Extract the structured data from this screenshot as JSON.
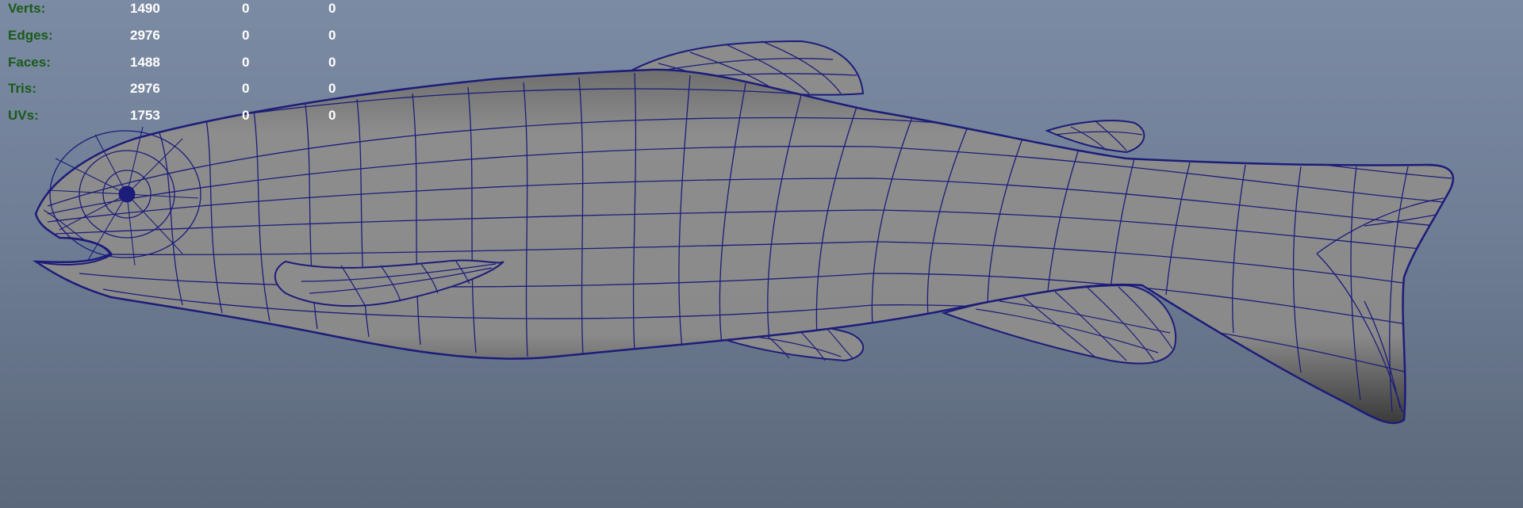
{
  "hud": {
    "rows": [
      {
        "label": "Verts:",
        "v1": "1490",
        "v2": "0",
        "v3": "0"
      },
      {
        "label": "Edges:",
        "v1": "2976",
        "v2": "0",
        "v3": "0"
      },
      {
        "label": "Faces:",
        "v1": "1488",
        "v2": "0",
        "v3": "0"
      },
      {
        "label": "Tris:",
        "v1": "2976",
        "v2": "0",
        "v3": "0"
      },
      {
        "label": "UVs:",
        "v1": "1753",
        "v2": "0",
        "v3": "0"
      }
    ]
  },
  "colors": {
    "background_top": "#7b8ba3",
    "background_bottom": "#5b677a",
    "mesh_fill": "#8a8a8a",
    "wire": "#1c1c7a",
    "hud_label": "#1a5a1a",
    "hud_value": "#ffffff"
  },
  "model": {
    "name_icon": "fish-mesh-wireframe"
  }
}
